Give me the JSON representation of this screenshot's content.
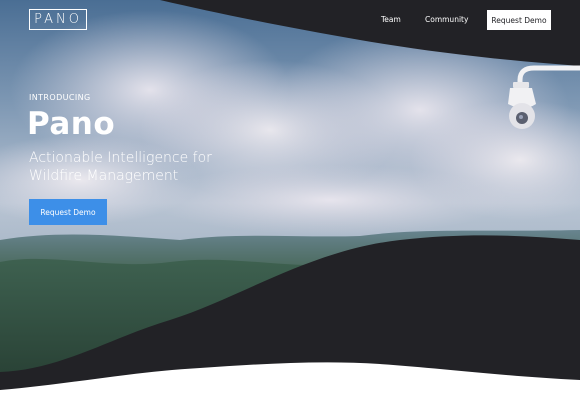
{
  "brand": {
    "logo_text": "PANO"
  },
  "nav": {
    "links": [
      {
        "label": "Team"
      },
      {
        "label": "Community"
      }
    ],
    "cta_label": "Request Demo"
  },
  "hero": {
    "eyebrow": "INTRODUCING",
    "headline": "Pano",
    "tagline": "Actionable Intelligence for Wildfire Management",
    "cta_label": "Request Demo",
    "background_icon": "camera-icon"
  },
  "colors": {
    "dark": "#222226",
    "accent": "#3d8fe8",
    "white": "#ffffff"
  }
}
